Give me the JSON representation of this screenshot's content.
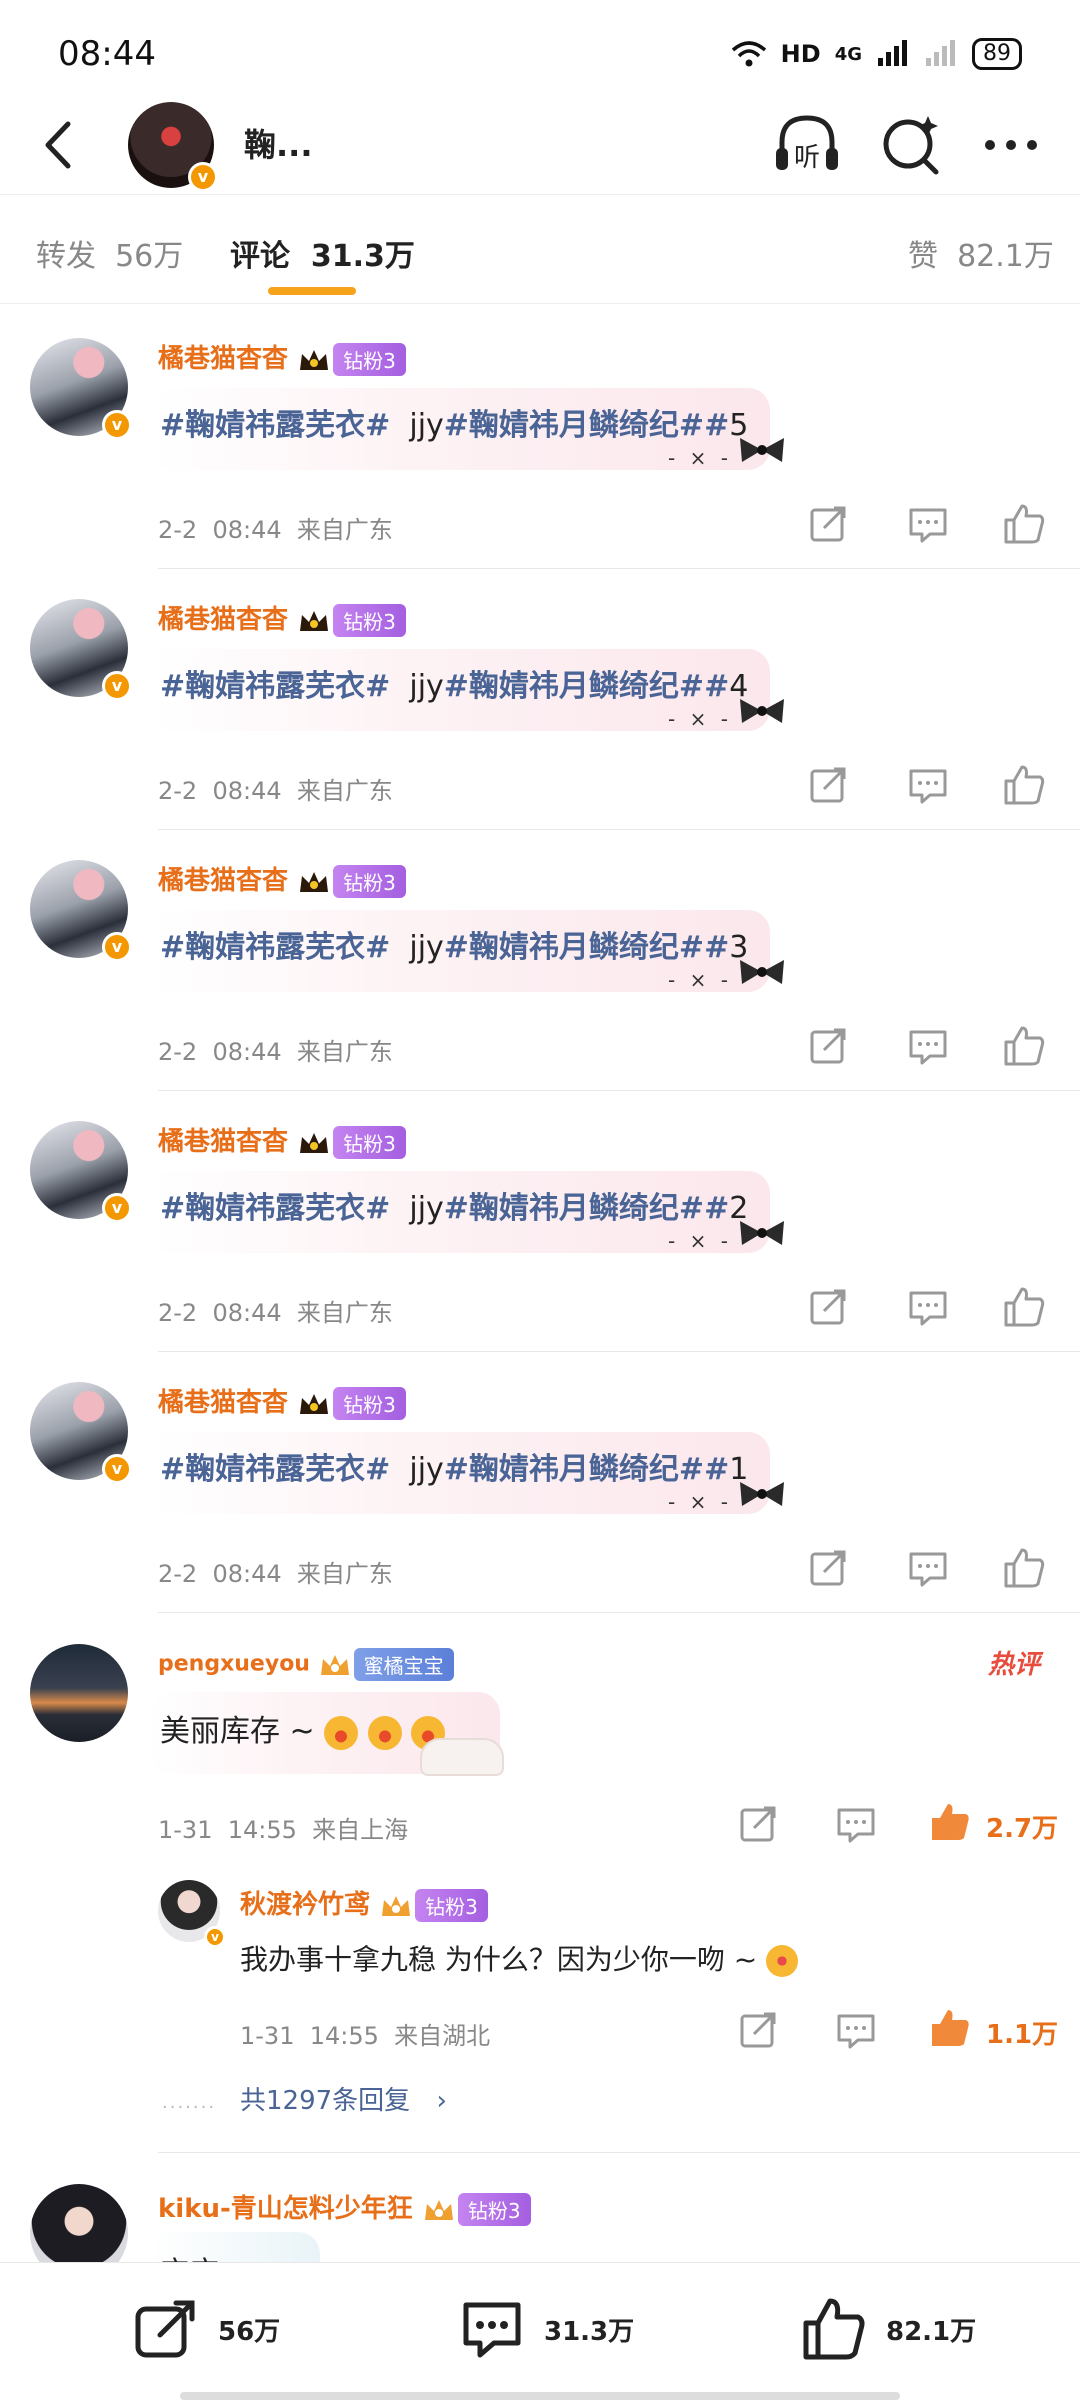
{
  "status": {
    "time": "08:44",
    "network": "HD",
    "signal": "4G",
    "battery": "89"
  },
  "header": {
    "name": "鞠..."
  },
  "tabs": [
    {
      "label": "转发",
      "count": "56万"
    },
    {
      "label": "评论",
      "count": "31.3万"
    },
    {
      "label": "赞",
      "count": "82.1万"
    }
  ],
  "comments": [
    {
      "user": "橘巷猫杳杳",
      "badge": "钻粉3",
      "tag1": "#鞠婧祎露芜衣#",
      "mid": "jjy",
      "tag2": "#鞠婧祎月鳞绮纪#",
      "num": "5",
      "date": "2-2",
      "time": "08:44",
      "loc": "来自广东"
    },
    {
      "user": "橘巷猫杳杳",
      "badge": "钻粉3",
      "tag1": "#鞠婧祎露芜衣#",
      "mid": "jjy",
      "tag2": "#鞠婧祎月鳞绮纪#",
      "num": "4",
      "date": "2-2",
      "time": "08:44",
      "loc": "来自广东"
    },
    {
      "user": "橘巷猫杳杳",
      "badge": "钻粉3",
      "tag1": "#鞠婧祎露芜衣#",
      "mid": "jjy",
      "tag2": "#鞠婧祎月鳞绮纪#",
      "num": "3",
      "date": "2-2",
      "time": "08:44",
      "loc": "来自广东"
    },
    {
      "user": "橘巷猫杳杳",
      "badge": "钻粉3",
      "tag1": "#鞠婧祎露芜衣#",
      "mid": "jjy",
      "tag2": "#鞠婧祎月鳞绮纪#",
      "num": "2",
      "date": "2-2",
      "time": "08:44",
      "loc": "来自广东"
    },
    {
      "user": "橘巷猫杳杳",
      "badge": "钻粉3",
      "tag1": "#鞠婧祎露芜衣#",
      "mid": "jjy",
      "tag2": "#鞠婧祎月鳞绮纪#",
      "num": "1",
      "date": "2-2",
      "time": "08:44",
      "loc": "来自广东"
    }
  ],
  "hot_comment": {
    "user": "pengxueyou",
    "badge": "蜜橘宝宝",
    "hot_label": "热评",
    "text": "美丽库存 ~",
    "date": "1-31",
    "time": "14:55",
    "loc": "来自上海",
    "likes": "2.7万",
    "reply": {
      "user": "秋渡衿竹鸢",
      "badge": "钻粉3",
      "text": "我办事十拿九稳  为什么？因为少你一吻 ~",
      "date": "1-31",
      "time": "14:55",
      "loc": "来自湖北",
      "likes": "1.1万"
    },
    "more": "共1297条回复"
  },
  "last_comment": {
    "user": "kiku-青山怎料少年狂",
    "badge": "钻粉3",
    "text": "宝宝"
  },
  "bottom": {
    "repost": "56万",
    "comment": "31.3万",
    "like": "82.1万"
  },
  "colors": {
    "accent": "#f7a21b",
    "username": "#e86f1a",
    "topic": "#4a6496",
    "badge": "#a45ee0"
  }
}
